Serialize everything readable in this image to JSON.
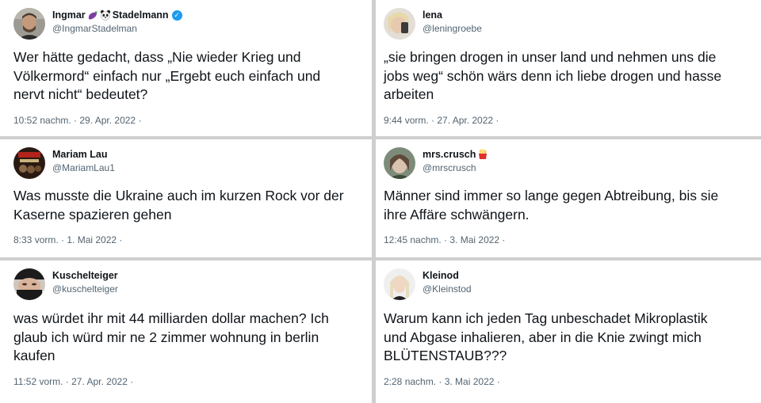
{
  "tweets": [
    {
      "display_name_a": "Ingmar",
      "display_name_b": "Stadelmann",
      "emoji_icons": [
        "eggplant-icon",
        "panda-icon"
      ],
      "verified": true,
      "handle": "@IngmarStadelman",
      "text": "Wer hätte gedacht, dass „Nie wieder Krieg und\nVölkermord“ einfach nur „Ergebt euch einfach und\nnervt nicht“ bedeutet?",
      "timestamp": "10:52 nachm. · 29. Apr. 2022 ·"
    },
    {
      "display_name": "lena",
      "handle": "@leningroebe",
      "text": "„sie bringen drogen in unser land und nehmen uns die\njobs weg“ schön wärs denn ich liebe drogen und hasse\narbeiten",
      "timestamp": "9:44 vorm. · 27. Apr. 2022 ·"
    },
    {
      "display_name": "Mariam Lau",
      "handle": "@MariamLau1",
      "text": "Was musste die Ukraine auch im kurzen Rock vor der\nKaserne spazieren gehen",
      "timestamp": "8:33 vorm. · 1. Mai 2022 ·"
    },
    {
      "display_name": "mrs.crusch",
      "emoji_icons": [
        "fries-icon"
      ],
      "handle": "@mrscrusch",
      "text": "Männer sind immer so lange gegen Abtreibung, bis sie\nihre Affäre schwängern.",
      "timestamp": "12:45 nachm. · 3. Mai 2022 ·"
    },
    {
      "display_name": "Kuschelteiger",
      "handle": "@kuschelteiger",
      "text": "was würdet ihr mit 44 milliarden dollar machen? Ich\nglaub ich würd mir ne 2 zimmer wohnung in berlin\nkaufen",
      "timestamp": "11:52 vorm. · 27. Apr. 2022 ·"
    },
    {
      "display_name": "Kleinod",
      "handle": "@Kleinstod",
      "text": "Warum kann ich jeden Tag unbeschadet Mikroplastik\nund Abgase inhalieren, aber in die Knie zwingt mich\nBLÜTENSTAUB???",
      "timestamp": "2:28 nachm. · 3. Mai 2022 ·"
    }
  ],
  "colors": {
    "background": "#cfcfcf",
    "card": "#ffffff",
    "text": "#0f1419",
    "secondary": "#536471",
    "verified": "#1d9bf0"
  }
}
